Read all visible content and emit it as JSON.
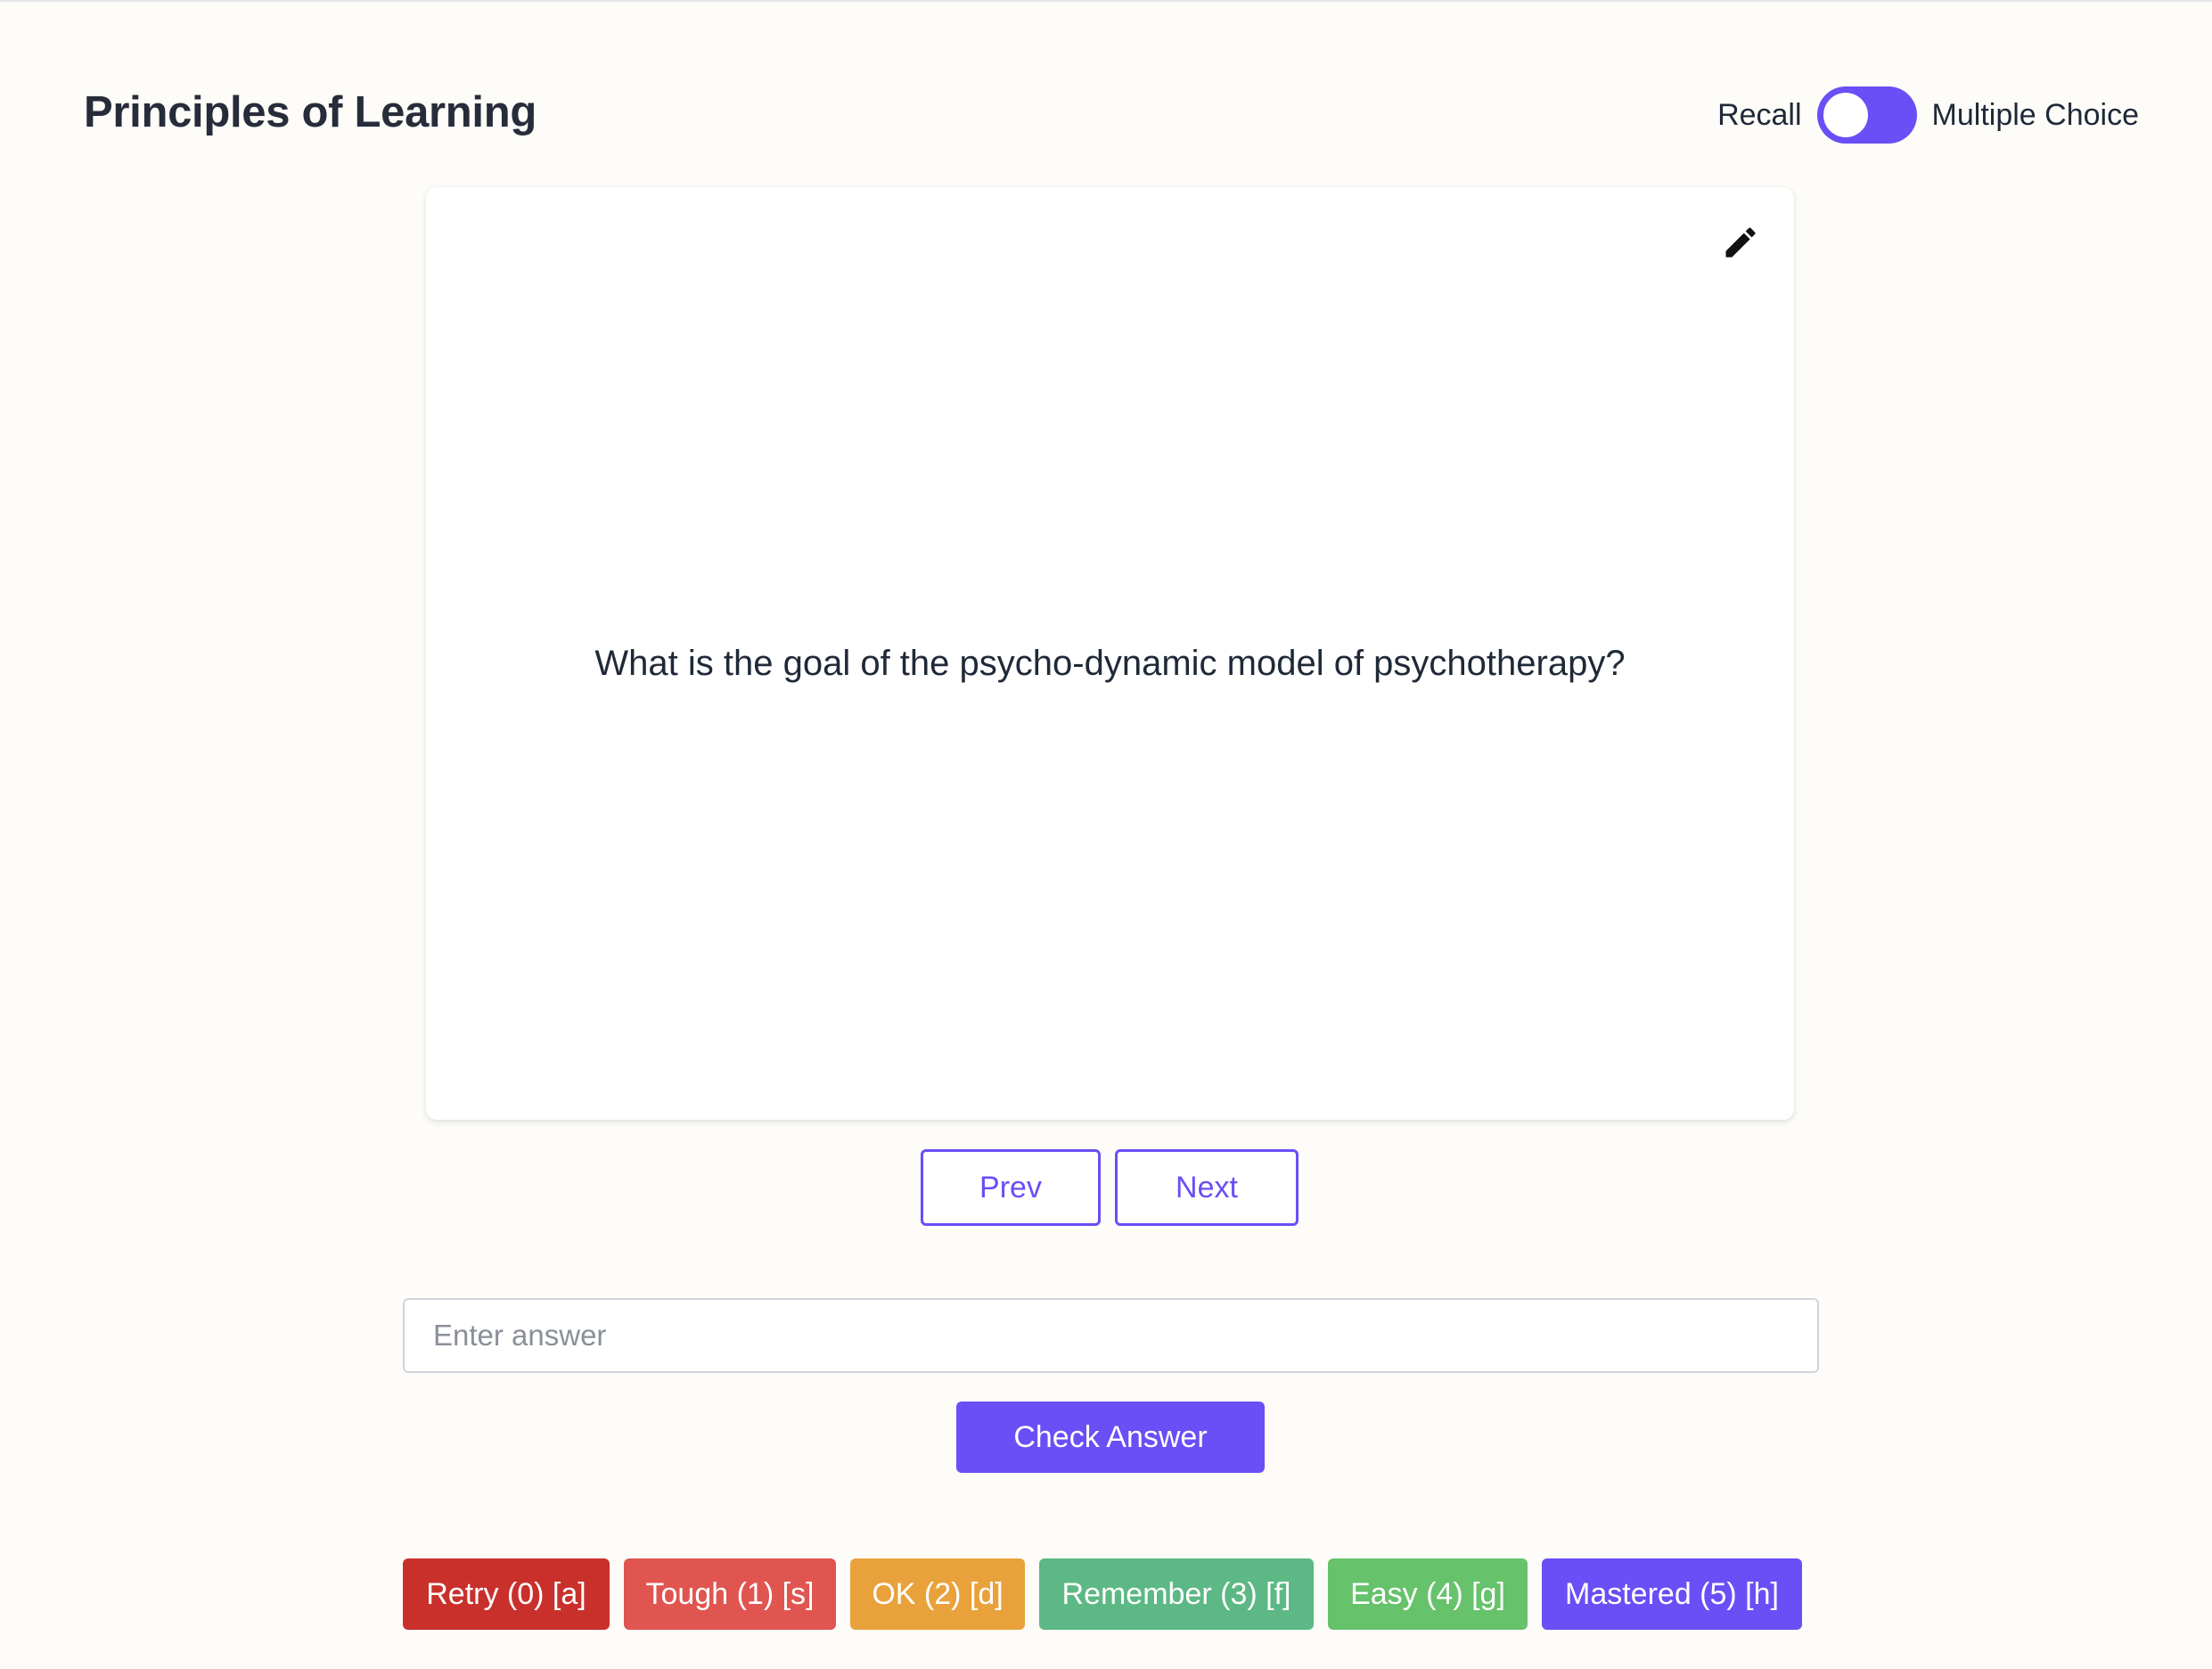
{
  "page": {
    "title": "Principles of Learning"
  },
  "mode_toggle": {
    "left_label": "Recall",
    "right_label": "Multiple Choice",
    "color": "#6a4ef6"
  },
  "card": {
    "question": "What is the goal of the psycho-dynamic model of psychotherapy?",
    "edit_icon": "pencil-icon"
  },
  "navigation": {
    "prev_label": "Prev",
    "next_label": "Next"
  },
  "answer": {
    "placeholder": "Enter answer",
    "value": "",
    "check_label": "Check Answer"
  },
  "ratings": [
    {
      "label": "Retry (0) [a]",
      "color": "#c9302c"
    },
    {
      "label": "Tough (1) [s]",
      "color": "#e05550"
    },
    {
      "label": "OK (2) [d]",
      "color": "#e9a23b"
    },
    {
      "label": "Remember (3) [f]",
      "color": "#5cb884"
    },
    {
      "label": "Easy (4) [g]",
      "color": "#66c26b"
    },
    {
      "label": "Mastered (5) [h]",
      "color": "#6a4ef6"
    }
  ],
  "colors": {
    "accent": "#6a4ef6",
    "background": "#fdfcf8"
  }
}
